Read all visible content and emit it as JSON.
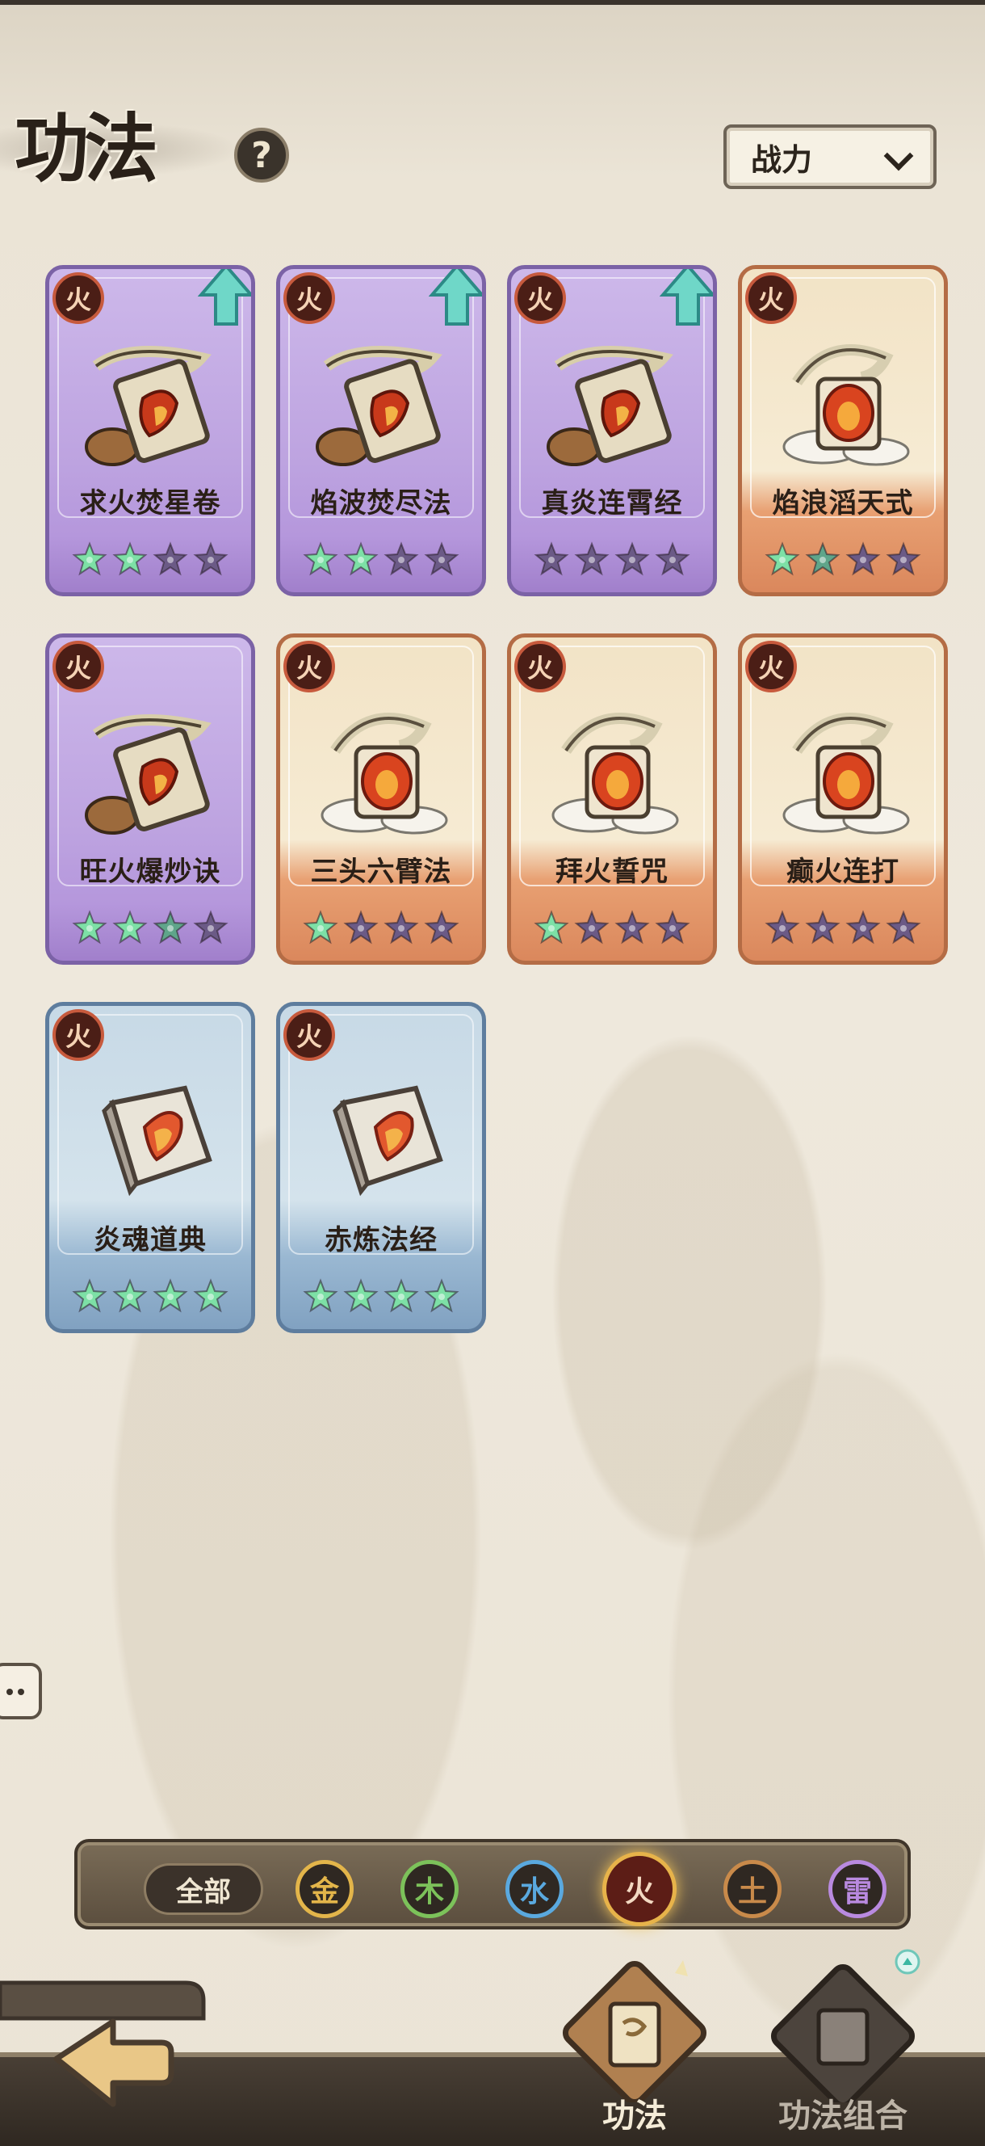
{
  "header": {
    "title": "功法",
    "help_glyph": "?",
    "sort_label": "战力"
  },
  "cards": [
    {
      "name": "求火焚星卷",
      "element": "火",
      "rarity": "purple",
      "upgrade": true,
      "stars_lit": 2,
      "stars_half": 0,
      "art": "scroll"
    },
    {
      "name": "焰波焚尽法",
      "element": "火",
      "rarity": "purple",
      "upgrade": true,
      "stars_lit": 2,
      "stars_half": 0,
      "art": "scroll"
    },
    {
      "name": "真炎连霄经",
      "element": "火",
      "rarity": "purple",
      "upgrade": true,
      "stars_lit": 0,
      "stars_half": 0,
      "art": "scroll"
    },
    {
      "name": "焰浪滔天式",
      "element": "火",
      "rarity": "orange",
      "upgrade": false,
      "stars_lit": 1,
      "stars_half": 1,
      "art": "dragon"
    },
    {
      "name": "旺火爆炒诀",
      "element": "火",
      "rarity": "purple",
      "upgrade": false,
      "stars_lit": 2,
      "stars_half": 1,
      "art": "scroll"
    },
    {
      "name": "三头六臂法",
      "element": "火",
      "rarity": "orange",
      "upgrade": false,
      "stars_lit": 1,
      "stars_half": 0,
      "art": "dragon"
    },
    {
      "name": "拜火誓咒",
      "element": "火",
      "rarity": "orange",
      "upgrade": false,
      "stars_lit": 1,
      "stars_half": 0,
      "art": "dragon"
    },
    {
      "name": "癫火连打",
      "element": "火",
      "rarity": "orange",
      "upgrade": false,
      "stars_lit": 0,
      "stars_half": 0,
      "art": "dragon"
    },
    {
      "name": "炎魂道典",
      "element": "火",
      "rarity": "blue",
      "upgrade": false,
      "stars_lit": 4,
      "stars_half": 0,
      "art": "book"
    },
    {
      "name": "赤炼法经",
      "element": "火",
      "rarity": "blue",
      "upgrade": false,
      "stars_lit": 4,
      "stars_half": 0,
      "art": "book"
    }
  ],
  "filter": {
    "all_label": "全部",
    "elements": [
      {
        "label": "金",
        "color": "#e3b54a"
      },
      {
        "label": "木",
        "color": "#7cc25a"
      },
      {
        "label": "水",
        "color": "#5aa9df"
      },
      {
        "label": "火",
        "color": "#e85a3a"
      },
      {
        "label": "土",
        "color": "#c98a4a"
      },
      {
        "label": "雷",
        "color": "#b98ae0"
      }
    ],
    "active": "火"
  },
  "nav": {
    "tab1_label": "功法",
    "tab2_label": "功法组合"
  },
  "colors": {
    "star_lit": "#7de0a6",
    "star_dim": "#6b5a86",
    "upgrade_arrow": "#6fd7c8"
  }
}
